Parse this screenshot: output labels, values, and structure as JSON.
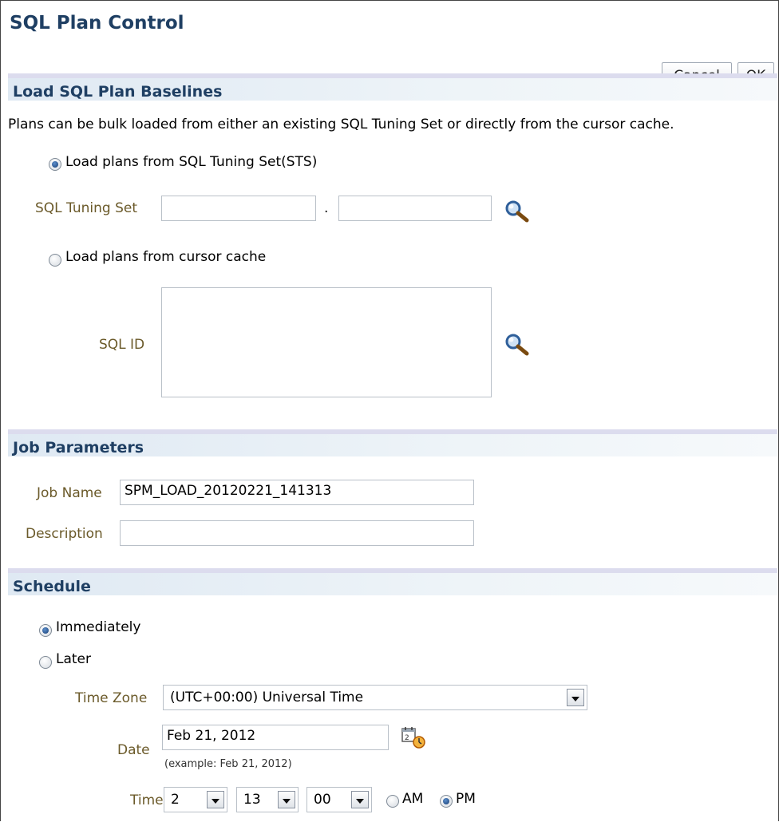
{
  "page": {
    "title": "SQL Plan Control"
  },
  "toolbar": {
    "cancel_label": "Cancel",
    "ok_label": "OK"
  },
  "load": {
    "title": "Load SQL Plan Baselines",
    "description": "Plans can be bulk loaded from either an existing SQL Tuning Set or directly from the cursor cache.",
    "sts_option": "Load plans from SQL Tuning Set(STS)",
    "sts_selected": true,
    "sts_label": "SQL Tuning Set",
    "sts_owner_value": "",
    "sts_separator": ".",
    "sts_name_value": "",
    "cursor_option": "Load plans from cursor cache",
    "sql_id_label": "SQL ID",
    "sql_id_value": ""
  },
  "job": {
    "title": "Job Parameters",
    "name_label": "Job Name",
    "name_value": "SPM_LOAD_20120221_141313",
    "description_label": "Description",
    "description_value": ""
  },
  "schedule": {
    "title": "Schedule",
    "immediately_label": "Immediately",
    "immediately_selected": true,
    "later_label": "Later",
    "timezone_label": "Time Zone",
    "timezone_value": "(UTC+00:00) Universal Time",
    "date_label": "Date",
    "date_value": "Feb 21, 2012",
    "date_hint": "(example: Feb 21, 2012)",
    "time_label": "Time",
    "hour_value": "2",
    "minute_value": "13",
    "second_value": "00",
    "am_label": "AM",
    "pm_label": "PM",
    "pm_selected": true
  },
  "icons": {
    "search": "search-icon",
    "calendar": "calendar-icon",
    "dropdown": "chevron-down-icon"
  },
  "colors": {
    "title": "#1f3f63",
    "label": "#6b5a2a",
    "section_band": "#dcdcee"
  }
}
